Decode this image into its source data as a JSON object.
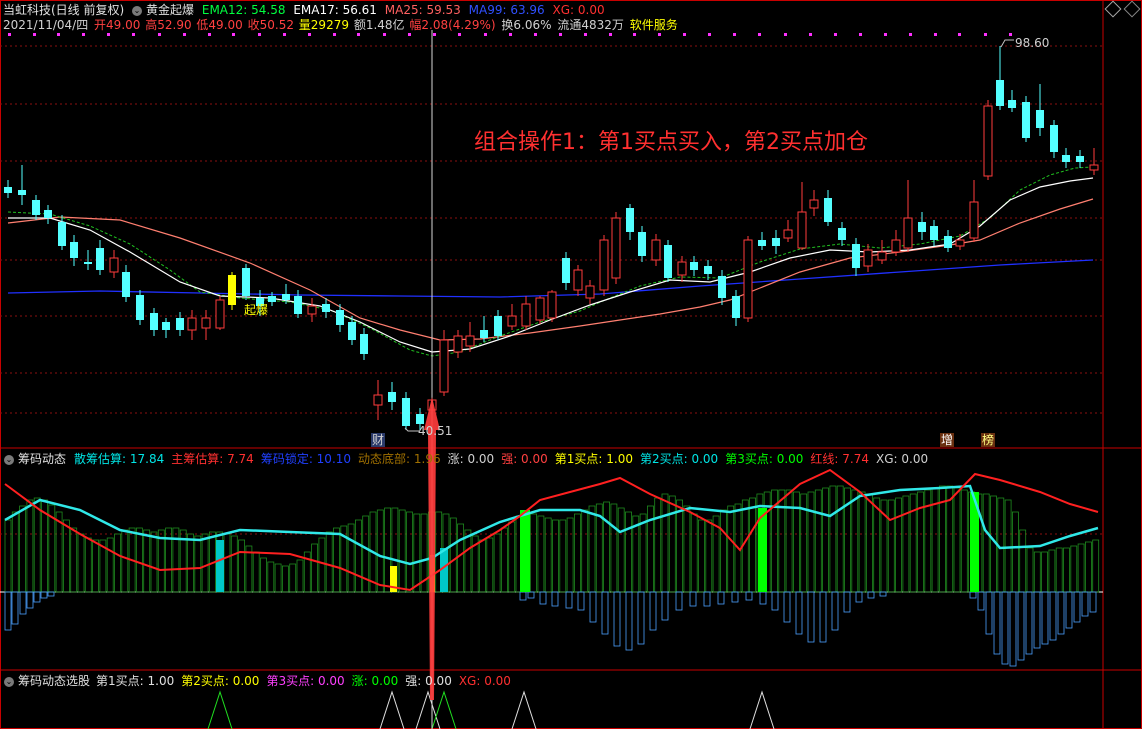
{
  "header": {
    "stock_name": "当虹科技(日线 前复权)",
    "indicator_name": "黄金起爆",
    "ema12": "EMA12: 54.58",
    "ema17": "EMA17: 56.61",
    "ma25": "MA25: 59.53",
    "ma99": "MA99: 63.96",
    "xg": "XG: 0.00"
  },
  "quote": {
    "date": "2021/11/04/四",
    "open": "开49.00",
    "high": "高52.90",
    "low": "低49.00",
    "close": "收50.52",
    "volume": "量29279",
    "amount": "额1.48亿",
    "change": "幅2.08(4.29%)",
    "turnover": "换6.06%",
    "float": "流通4832万",
    "sector": "软件服务"
  },
  "main_chart": {
    "annotation": "组合操作1：第1买点买入，第2买点加仓",
    "high_label": "98.60",
    "low_label": "40.51",
    "signal_label": "起爆",
    "badges": [
      "财",
      "增",
      "榜"
    ]
  },
  "panel2": {
    "name": "筹码动态",
    "items": [
      {
        "text": "散筹估算: 17.84",
        "color": "#00e5e5"
      },
      {
        "text": "主筹估算: 7.74",
        "color": "#ff3030"
      },
      {
        "text": "筹码锁定: 10.10",
        "color": "#2040ff"
      },
      {
        "text": "动态底部: 1.96",
        "color": "#a07000"
      },
      {
        "text": "涨: 0.00",
        "color": "#d0d0d0"
      },
      {
        "text": "强: 0.00",
        "color": "#ff4040"
      },
      {
        "text": "第1买点: 1.00",
        "color": "#ffff00"
      },
      {
        "text": "第2买点: 0.00",
        "color": "#00e5e5"
      },
      {
        "text": "第3买点: 0.00",
        "color": "#00ff00"
      },
      {
        "text": "红线: 7.74",
        "color": "#ff3030"
      },
      {
        "text": "XG: 0.00",
        "color": "#d0d0d0"
      }
    ]
  },
  "panel3": {
    "name": "筹码动态选股",
    "items": [
      {
        "text": "第1买点: 1.00",
        "color": "#e0e0e0"
      },
      {
        "text": "第2买点: 0.00",
        "color": "#ffff00"
      },
      {
        "text": "第3买点: 0.00",
        "color": "#ff40ff"
      },
      {
        "text": "涨: 0.00",
        "color": "#00ff00"
      },
      {
        "text": "强: 0.00",
        "color": "#e0e0e0"
      },
      {
        "text": "XG: 0.00",
        "color": "#ff3030"
      }
    ]
  },
  "colors": {
    "up": "#ff3c3c",
    "down": "#54ffff",
    "frame": "#c80000",
    "ma99": "#2030ff",
    "ema12": "#ffffff",
    "ma25": "#ff7f70",
    "dashed": "#20c020",
    "signal_yellow": "#ffff00",
    "signal_green": "#00ff00",
    "signal_cyan": "#00c8c8"
  }
}
